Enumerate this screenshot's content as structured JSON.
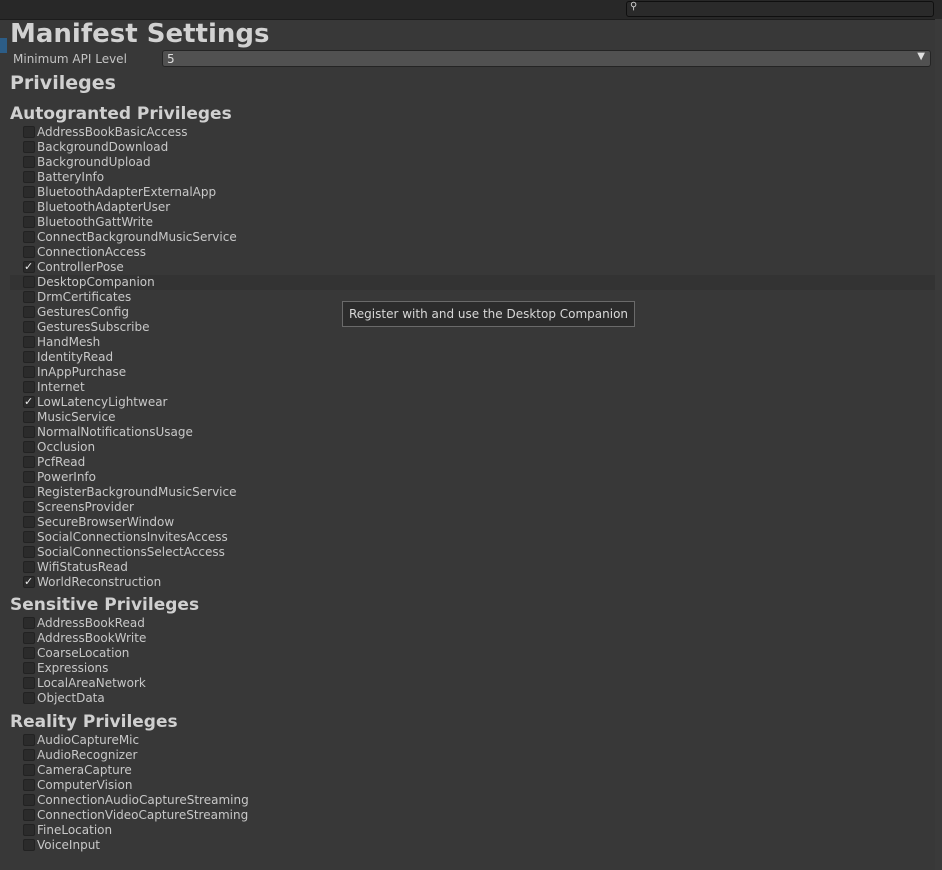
{
  "header": {
    "title": "Manifest Settings"
  },
  "api": {
    "label": "Minimum API Level",
    "value": "5"
  },
  "privileges": {
    "title": "Privileges"
  },
  "autogranted": {
    "title": "Autogranted Privileges",
    "items": [
      {
        "label": "AddressBookBasicAccess",
        "checked": false
      },
      {
        "label": "BackgroundDownload",
        "checked": false
      },
      {
        "label": "BackgroundUpload",
        "checked": false
      },
      {
        "label": "BatteryInfo",
        "checked": false
      },
      {
        "label": "BluetoothAdapterExternalApp",
        "checked": false
      },
      {
        "label": "BluetoothAdapterUser",
        "checked": false
      },
      {
        "label": "BluetoothGattWrite",
        "checked": false
      },
      {
        "label": "ConnectBackgroundMusicService",
        "checked": false
      },
      {
        "label": "ConnectionAccess",
        "checked": false
      },
      {
        "label": "ControllerPose",
        "checked": true
      },
      {
        "label": "DesktopCompanion",
        "checked": false,
        "hover": true
      },
      {
        "label": "DrmCertificates",
        "checked": false
      },
      {
        "label": "GesturesConfig",
        "checked": false
      },
      {
        "label": "GesturesSubscribe",
        "checked": false
      },
      {
        "label": "HandMesh",
        "checked": false
      },
      {
        "label": "IdentityRead",
        "checked": false
      },
      {
        "label": "InAppPurchase",
        "checked": false
      },
      {
        "label": "Internet",
        "checked": false
      },
      {
        "label": "LowLatencyLightwear",
        "checked": true
      },
      {
        "label": "MusicService",
        "checked": false
      },
      {
        "label": "NormalNotificationsUsage",
        "checked": false
      },
      {
        "label": "Occlusion",
        "checked": false
      },
      {
        "label": "PcfRead",
        "checked": false
      },
      {
        "label": "PowerInfo",
        "checked": false
      },
      {
        "label": "RegisterBackgroundMusicService",
        "checked": false
      },
      {
        "label": "ScreensProvider",
        "checked": false
      },
      {
        "label": "SecureBrowserWindow",
        "checked": false
      },
      {
        "label": "SocialConnectionsInvitesAccess",
        "checked": false
      },
      {
        "label": "SocialConnectionsSelectAccess",
        "checked": false
      },
      {
        "label": "WifiStatusRead",
        "checked": false
      },
      {
        "label": "WorldReconstruction",
        "checked": true
      }
    ]
  },
  "sensitive": {
    "title": "Sensitive Privileges",
    "items": [
      {
        "label": "AddressBookRead",
        "checked": false
      },
      {
        "label": "AddressBookWrite",
        "checked": false
      },
      {
        "label": "CoarseLocation",
        "checked": false
      },
      {
        "label": "Expressions",
        "checked": false
      },
      {
        "label": "LocalAreaNetwork",
        "checked": false
      },
      {
        "label": "ObjectData",
        "checked": false
      }
    ]
  },
  "reality": {
    "title": "Reality Privileges",
    "items": [
      {
        "label": "AudioCaptureMic",
        "checked": false
      },
      {
        "label": "AudioRecognizer",
        "checked": false
      },
      {
        "label": "CameraCapture",
        "checked": false
      },
      {
        "label": "ComputerVision",
        "checked": false
      },
      {
        "label": "ConnectionAudioCaptureStreaming",
        "checked": false
      },
      {
        "label": "ConnectionVideoCaptureStreaming",
        "checked": false
      },
      {
        "label": "FineLocation",
        "checked": false
      },
      {
        "label": "VoiceInput",
        "checked": false
      }
    ]
  },
  "tooltip": {
    "text": "Register with and use the Desktop Companion"
  },
  "icons": {
    "search": "search-icon",
    "dropdown": "chevron-down-icon",
    "check": "checkmark-icon"
  }
}
